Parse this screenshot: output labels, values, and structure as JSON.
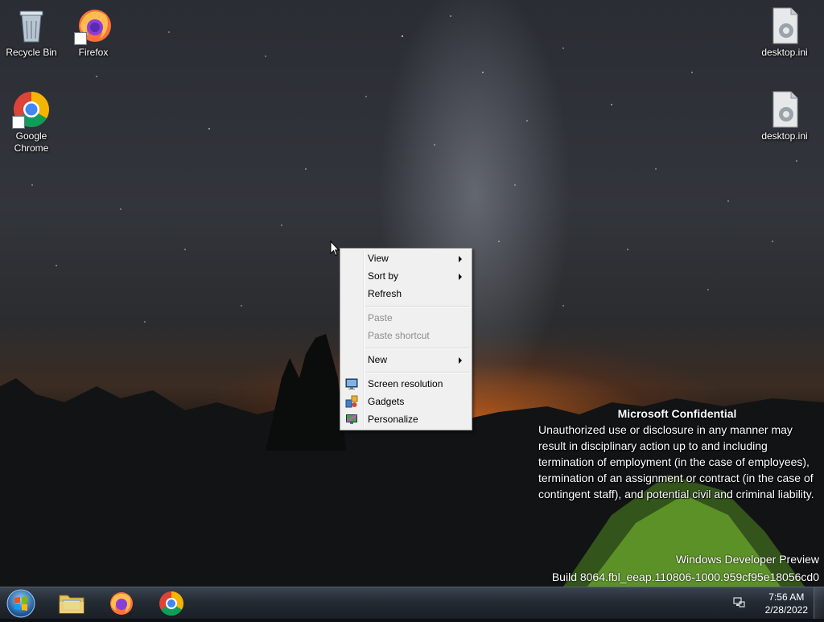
{
  "desktop": {
    "icons": [
      {
        "label": "Recycle Bin",
        "icon": "recycle-bin-icon"
      },
      {
        "label": "Firefox",
        "icon": "firefox-icon"
      },
      {
        "label": "Google Chrome",
        "icon": "chrome-icon"
      },
      {
        "label": "desktop.ini",
        "icon": "ini-file-icon"
      },
      {
        "label": "desktop.ini",
        "icon": "ini-file-icon"
      }
    ]
  },
  "context_menu": {
    "items": [
      {
        "label": "View",
        "submenu": true,
        "enabled": true
      },
      {
        "label": "Sort by",
        "submenu": true,
        "enabled": true
      },
      {
        "label": "Refresh",
        "submenu": false,
        "enabled": true
      },
      {
        "label": "Paste",
        "submenu": false,
        "enabled": false
      },
      {
        "label": "Paste shortcut",
        "submenu": false,
        "enabled": false
      },
      {
        "label": "New",
        "submenu": true,
        "enabled": true
      },
      {
        "label": "Screen resolution",
        "submenu": false,
        "enabled": true,
        "icon": "screen-resolution-icon"
      },
      {
        "label": "Gadgets",
        "submenu": false,
        "enabled": true,
        "icon": "gadgets-icon"
      },
      {
        "label": "Personalize",
        "submenu": false,
        "enabled": true,
        "icon": "personalize-icon"
      }
    ]
  },
  "notice": {
    "title": "Microsoft Confidential",
    "body": "Unauthorized use or disclosure in any manner may result in disciplinary action up to and including termination of employment (in the case of employees), termination of an assignment or contract (in the case of contingent staff), and potential civil and criminal liability."
  },
  "build_watermark": {
    "line1": "Windows Developer Preview",
    "line2": "Build 8064.fbl_eeap.110806-1000.959cf95e18056cd0"
  },
  "taskbar": {
    "pinned": [
      "file-explorer-icon",
      "firefox-icon",
      "chrome-icon"
    ],
    "clock_time": "7:56 AM",
    "clock_date": "2/28/2022"
  },
  "colors": {
    "menu_bg": "#f0f0f0",
    "menu_border": "#979797",
    "disabled_text": "#8d8d8d",
    "taskbar": "#242b33"
  }
}
